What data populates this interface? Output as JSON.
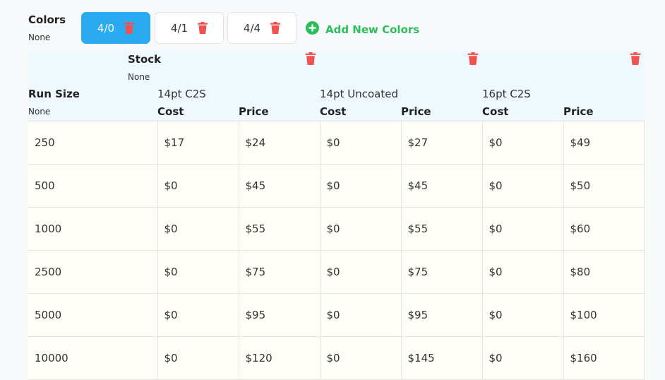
{
  "colors": {
    "title": "Colors",
    "subtitle": "None",
    "tabs": [
      {
        "label": "4/0",
        "active": true
      },
      {
        "label": "4/1",
        "active": false
      },
      {
        "label": "4/4",
        "active": false
      }
    ],
    "add_label": "Add New Colors"
  },
  "stock": {
    "title": "Stock",
    "subtitle": "None"
  },
  "run_size": {
    "title": "Run Size",
    "subtitle": "None"
  },
  "stocks": [
    {
      "name": "14pt C2S",
      "cost_label": "Cost",
      "price_label": "Price"
    },
    {
      "name": "14pt Uncoated",
      "cost_label": "Cost",
      "price_label": "Price"
    },
    {
      "name": "16pt C2S",
      "cost_label": "Cost",
      "price_label": "Price"
    }
  ],
  "rows": [
    {
      "run": "250",
      "cells": [
        "$17",
        "$24",
        "$0",
        "$27",
        "$0",
        "$49"
      ]
    },
    {
      "run": "500",
      "cells": [
        "$0",
        "$45",
        "$0",
        "$45",
        "$0",
        "$50"
      ]
    },
    {
      "run": "1000",
      "cells": [
        "$0",
        "$55",
        "$0",
        "$55",
        "$0",
        "$60"
      ]
    },
    {
      "run": "2500",
      "cells": [
        "$0",
        "$75",
        "$0",
        "$75",
        "$0",
        "$80"
      ]
    },
    {
      "run": "5000",
      "cells": [
        "$0",
        "$95",
        "$0",
        "$95",
        "$0",
        "$100"
      ]
    },
    {
      "run": "10000",
      "cells": [
        "$0",
        "$120",
        "$0",
        "$145",
        "$0",
        "$160"
      ]
    }
  ],
  "theme": {
    "accent": "#2aaaf0",
    "add_green": "#2bbf5b",
    "trash_red": "#ef5350",
    "header_bg": "#eef8fd",
    "body_bg": "#fffef6"
  },
  "icons": {
    "trash": "trash-icon",
    "add": "plus-circle-icon"
  }
}
